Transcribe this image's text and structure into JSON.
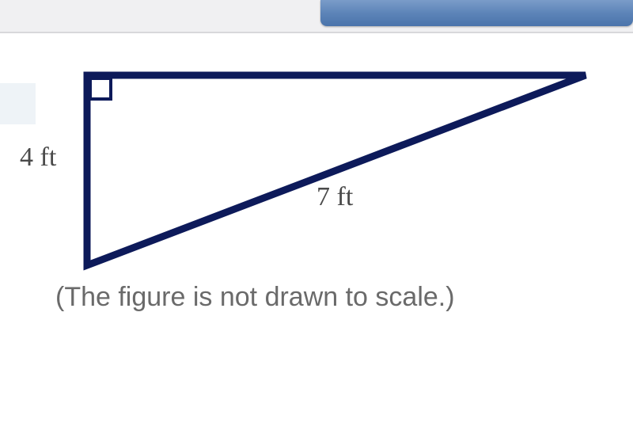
{
  "labels": {
    "side_a": "4 ft",
    "hypotenuse": "7 ft"
  },
  "caption": "(The figure is not drawn to scale.)",
  "colors": {
    "triangle_stroke": "#0d1a5a",
    "top_bar_bg": "#f0f0f2",
    "blue_tab_top": "#7a9cc9",
    "blue_tab_bottom": "#4a74ab",
    "left_block": "#eef3f7"
  },
  "chart_data": {
    "type": "diagram",
    "shape": "right_triangle",
    "right_angle_at": "top-left",
    "sides": [
      {
        "name": "vertical_leg",
        "length": 4,
        "unit": "ft",
        "label_position": "left"
      },
      {
        "name": "hypotenuse",
        "length": 7,
        "unit": "ft",
        "label_position": "below"
      }
    ],
    "note": "The figure is not drawn to scale."
  }
}
